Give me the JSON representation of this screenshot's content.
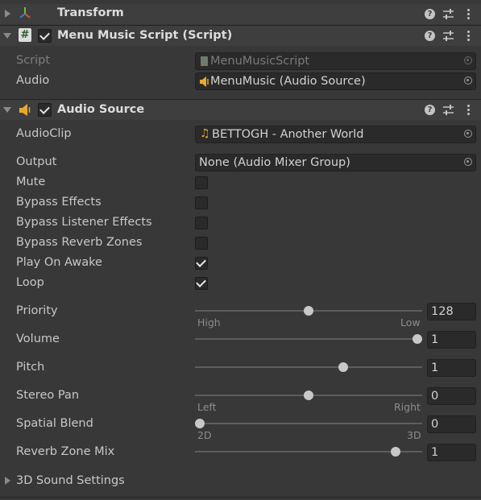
{
  "components": {
    "transform": {
      "title": "Transform"
    },
    "menu_music": {
      "title": "Menu Music Script (Script)",
      "enabled": true
    },
    "audio_source": {
      "title": "Audio Source",
      "enabled": true
    }
  },
  "menu_music": {
    "script_label": "Script",
    "script_value": "MenuMusicScript",
    "audio_label": "Audio",
    "audio_value": "MenuMusic (Audio Source)"
  },
  "audio_source": {
    "audioclip_label": "AudioClip",
    "audioclip_value": "BETTOGH - Another World",
    "output_label": "Output",
    "output_value": "None (Audio Mixer Group)",
    "toggles": [
      {
        "label": "Mute",
        "checked": false
      },
      {
        "label": "Bypass Effects",
        "checked": false
      },
      {
        "label": "Bypass Listener Effects",
        "checked": false
      },
      {
        "label": "Bypass Reverb Zones",
        "checked": false
      },
      {
        "label": "Play On Awake",
        "checked": true
      },
      {
        "label": "Loop",
        "checked": true
      }
    ],
    "sliders": [
      {
        "label": "Priority",
        "value": "128",
        "fraction": 0.5,
        "min_caption": "High",
        "max_caption": "Low"
      },
      {
        "label": "Volume",
        "value": "1",
        "fraction": 1.0
      },
      {
        "label": "Pitch",
        "value": "1",
        "fraction": 0.66
      },
      {
        "label": "Stereo Pan",
        "value": "0",
        "fraction": 0.5,
        "min_caption": "Left",
        "max_caption": "Right"
      },
      {
        "label": "Spatial Blend",
        "value": "0",
        "fraction": 0.0,
        "min_caption": "2D",
        "max_caption": "3D"
      },
      {
        "label": "Reverb Zone Mix",
        "value": "1",
        "fraction": 0.9
      }
    ],
    "sound_settings_label": "3D Sound Settings"
  },
  "icons": [
    "transform-axes-icon",
    "script-hash-icon",
    "audio-speaker-icon",
    "help-icon",
    "presets-icon",
    "more-menu-icon",
    "picker-icon",
    "music-note-icon"
  ],
  "colors": {
    "background": "#383838",
    "header": "#3e3e3e",
    "field": "#2a2a2a",
    "text": "#c8c8c8"
  }
}
